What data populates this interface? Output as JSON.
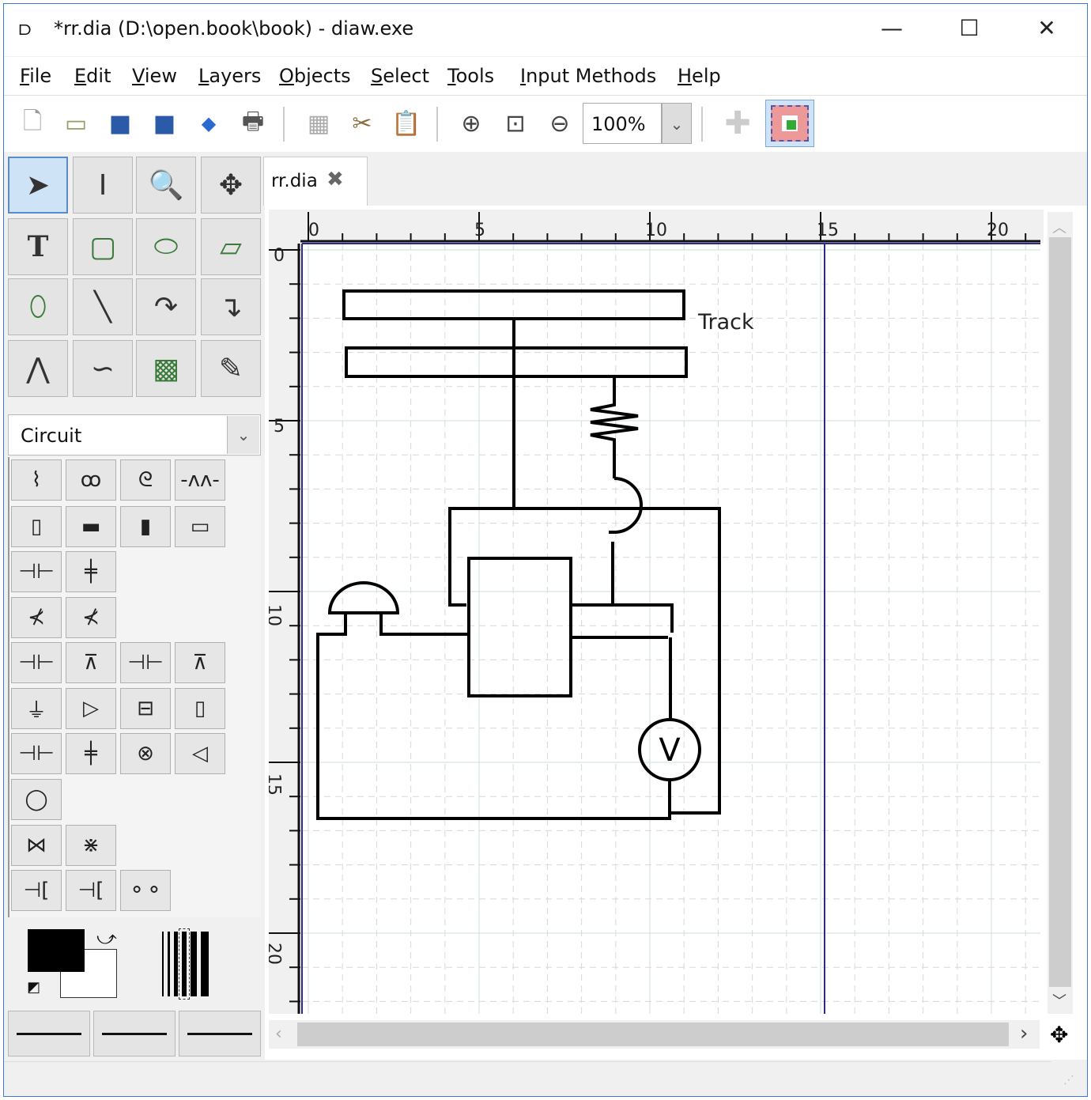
{
  "window": {
    "title": "*rr.dia (D:\\open.book\\book) - diaw.exe",
    "minimize": "—",
    "maximize": "☐",
    "close": "✕"
  },
  "menu": [
    {
      "label": "File",
      "key": "F",
      "rest": "ile"
    },
    {
      "label": "Edit",
      "key": "E",
      "rest": "dit"
    },
    {
      "label": "View",
      "key": "V",
      "rest": "iew"
    },
    {
      "label": "Layers",
      "key": "L",
      "rest": "ayers"
    },
    {
      "label": "Objects",
      "key": "O",
      "rest": "bjects"
    },
    {
      "label": "Select",
      "key": "S",
      "rest": "elect"
    },
    {
      "label": "Tools",
      "key": "T",
      "rest": "ools"
    },
    {
      "label": "Input Methods",
      "key": "I",
      "rest": "nput Methods"
    },
    {
      "label": "Help",
      "key": "H",
      "rest": "elp"
    }
  ],
  "toolbar": {
    "buttons": [
      "new",
      "open",
      "save",
      "save-as",
      "export",
      "print",
      "copy",
      "cut",
      "paste",
      "zoom-in",
      "zoom-fit",
      "zoom-out"
    ],
    "zoom_value": "100%"
  },
  "tools": [
    "pointer",
    "text-edit",
    "magnify",
    "scroll",
    "text",
    "box",
    "ellipse",
    "polygon",
    "beziergon",
    "line",
    "arc",
    "zigzag-line",
    "polyline",
    "bezier-line",
    "image",
    "outline"
  ],
  "sheet": {
    "selected": "Circuit"
  },
  "tab": {
    "label": "rr.dia",
    "close": "✖"
  },
  "ruler": {
    "top": [
      "0",
      "5",
      "10",
      "15",
      "20"
    ],
    "left": [
      "0",
      "5",
      "10",
      "15",
      "20"
    ]
  },
  "diagram": {
    "label": "Track",
    "voltmeter": "V"
  },
  "colors": {
    "foreground": "#000000",
    "background": "#ffffff",
    "page_border": "#2b2b8c",
    "accent": "#3b7bd6"
  }
}
